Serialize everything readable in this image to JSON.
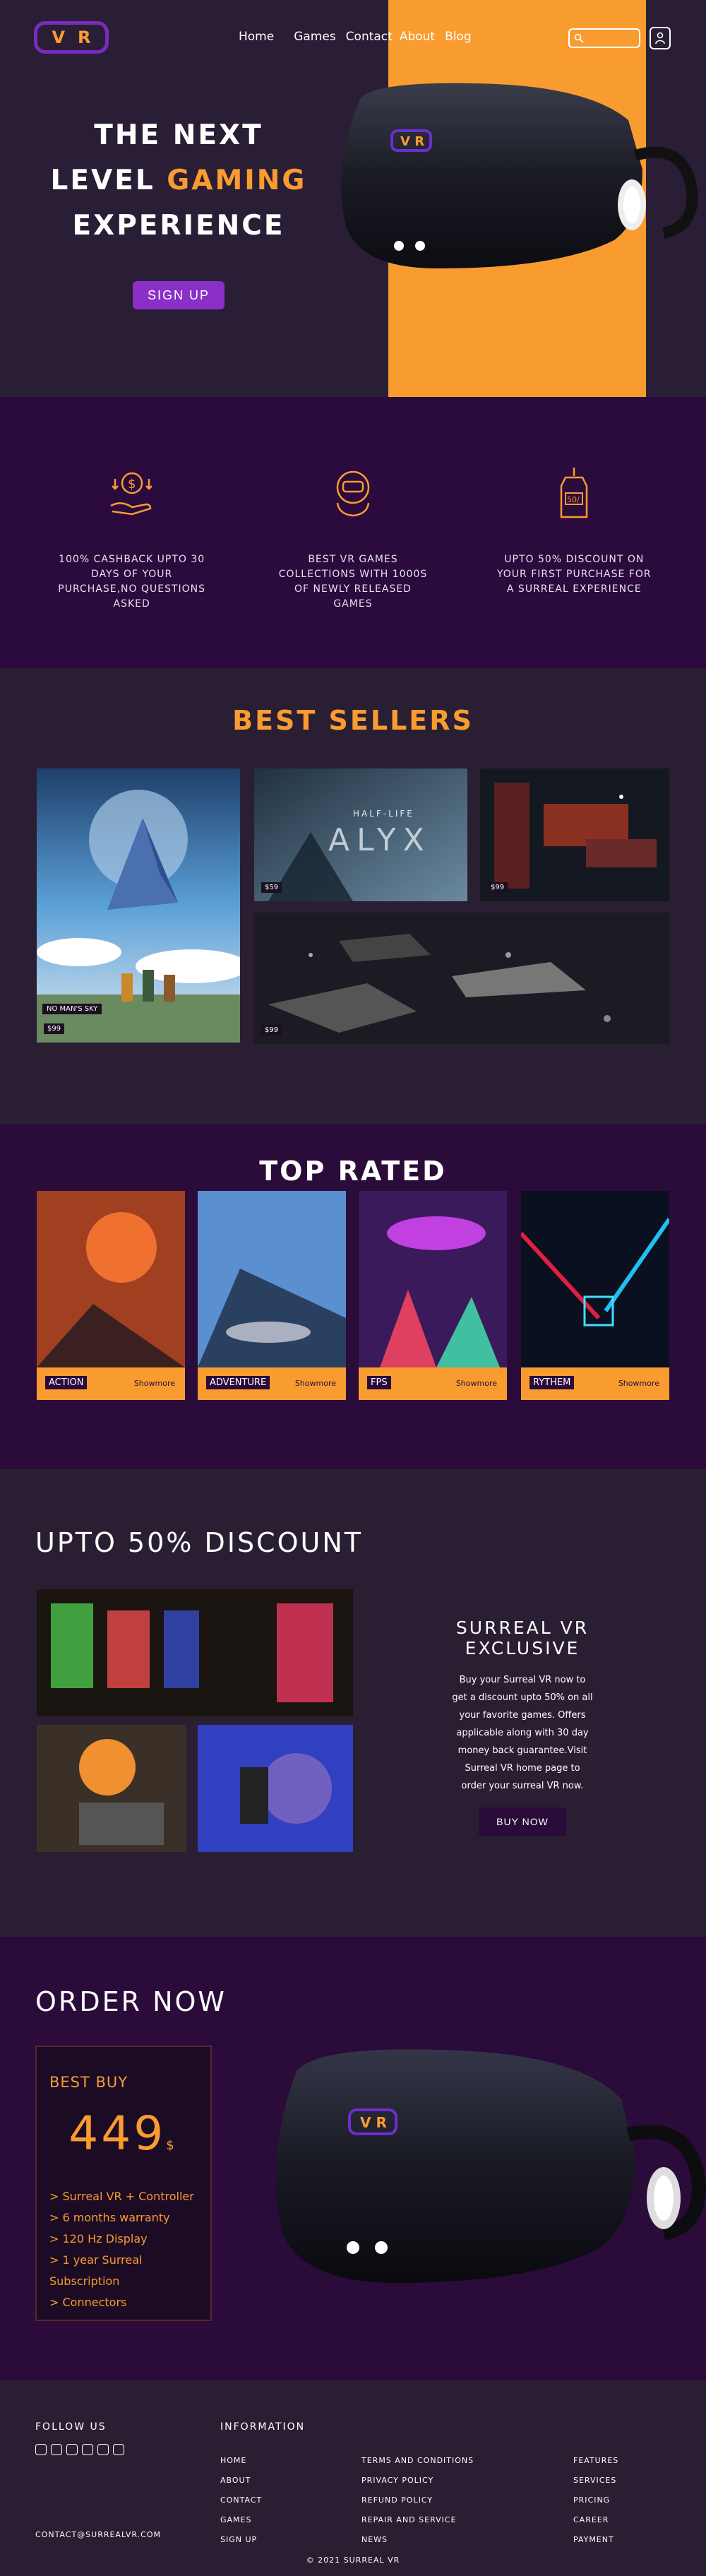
{
  "logo": {
    "left": "V",
    "right": "R"
  },
  "nav": [
    "Home",
    "Games",
    "Contact",
    "About",
    "Blog"
  ],
  "hero": {
    "line1": "THE NEXT",
    "line2a": "LEVEL",
    "line2b": "GAMING",
    "line3": "EXPERIENCE",
    "cta": "SIGN UP"
  },
  "features": [
    {
      "icon": "cashback-icon",
      "text": "100% CASHBACK UPTO 30 DAYS OF YOUR PURCHASE,NO QUESTIONS ASKED"
    },
    {
      "icon": "vr-collection-icon",
      "text": "BEST VR GAMES COLLECTIONS WITH 1000S OF NEWLY RELEASED GAMES"
    },
    {
      "icon": "discount-tag-icon",
      "text": "UPTO 50% DISCOUNT ON YOUR FIRST PURCHASE FOR A SURREAL EXPERIENCE"
    }
  ],
  "best_sellers": {
    "title": "BEST SELLERS",
    "items": [
      {
        "name": "NO MAN'S SKY",
        "price": "$99"
      },
      {
        "name": "HALF-LIFE ALYX",
        "price": "$59"
      },
      {
        "price": "$99"
      },
      {
        "price": "$99"
      }
    ],
    "alyx_logo_top": "HALF-LIFE",
    "alyx_logo_bottom": "ALYX"
  },
  "top_rated": {
    "title": "TOP RATED",
    "cards": [
      {
        "genre": "ACTION",
        "more": "Showmore"
      },
      {
        "genre": "ADVENTURE",
        "more": "Showmore"
      },
      {
        "genre": "FPS",
        "more": "Showmore"
      },
      {
        "genre": "RYTHEM",
        "more": "Showmore"
      }
    ]
  },
  "discount": {
    "title": "UPTO 50% DISCOUNT",
    "exclusive_title": "SURREAL VR EXCLUSIVE",
    "body": "Buy your Surreal VR now to get a discount upto 50% on all your favorite games. Offers applicable along with 30 day money back guarantee.Visit Surreal VR home page to order your surreal VR now.",
    "cta": "BUY NOW"
  },
  "order": {
    "title": "ORDER NOW",
    "label": "BEST BUY",
    "price": "449",
    "currency": "$",
    "items": [
      "> Surreal VR + Controller",
      "> 6 months warranty",
      "> 120 Hz Display",
      "> 1 year Surreal Subscription",
      "> Connectors"
    ]
  },
  "footer": {
    "follow": "FOLLOW US",
    "info": "INFORMATION",
    "col1": [
      "HOME",
      "ABOUT",
      "CONTACT",
      "GAMES",
      "SIGN UP"
    ],
    "col2": [
      "TERMS AND CONDITIONS",
      "PRIVACY POLICY",
      "REFUND POLICY",
      "REPAIR AND SERVICE",
      "NEWS"
    ],
    "col3": [
      "FEATURES",
      "SERVICES",
      "PRICING",
      "CAREER",
      "PAYMENT"
    ],
    "email": "CONTACT@SURREALVR.COM",
    "copyright": "© 2021 SURREAL VR"
  },
  "colors": {
    "accent": "#f99c30",
    "purple": "#8b2fc9",
    "bg": "#2a1e33",
    "deep": "#2a0b3a"
  }
}
